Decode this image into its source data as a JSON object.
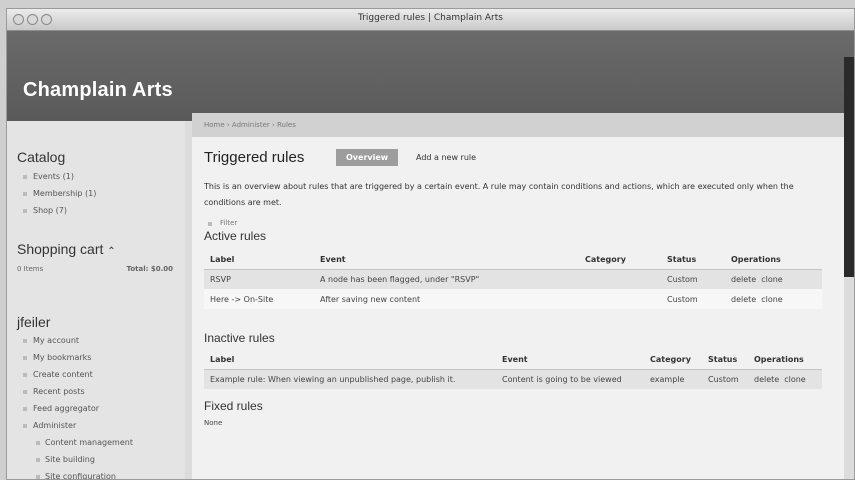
{
  "window": {
    "title": "Triggered rules | Champlain Arts"
  },
  "site": {
    "name": "Champlain Arts"
  },
  "breadcrumb": {
    "text": "Home › Administer › Rules"
  },
  "sidebar": {
    "catalog": {
      "title": "Catalog",
      "items": [
        "Events (1)",
        "Membership (1)",
        "Shop (7)"
      ]
    },
    "cart": {
      "title": "Shopping cart",
      "toggle": "⌃",
      "items_text": "0 Items",
      "total_text": "Total: $0.00"
    },
    "user": {
      "title": "jfeiler",
      "items": [
        "My account",
        "My bookmarks",
        "Create content",
        "Recent posts",
        "Feed aggregator",
        "Administer"
      ],
      "subitems": [
        "Content management",
        "Site building",
        "Site configuration"
      ]
    }
  },
  "main": {
    "title": "Triggered rules",
    "tabs": {
      "overview": "Overview",
      "add": "Add a new rule"
    },
    "description": "This is an overview about rules that are triggered by a certain event. A rule may contain conditions and actions, which are executed only when the conditions are met.",
    "filter_label": "Filter",
    "active": {
      "heading": "Active rules",
      "headers": [
        "Label",
        "Event",
        "Category",
        "Status",
        "Operations"
      ],
      "rows": [
        {
          "label": "RSVP",
          "event": "A node has been flagged, under \"RSVP\"",
          "category": "",
          "status": "Custom",
          "delete": "delete",
          "clone": "clone"
        },
        {
          "label": "Here -> On-Site",
          "event": "After saving new content",
          "category": "",
          "status": "Custom",
          "delete": "delete",
          "clone": "clone"
        }
      ]
    },
    "inactive": {
      "heading": "Inactive rules",
      "headers": [
        "Label",
        "Event",
        "Category",
        "Status",
        "Operations"
      ],
      "rows": [
        {
          "label": "Example rule: When viewing an unpublished page, publish it.",
          "event": "Content is going to be viewed",
          "category": "example",
          "status": "Custom",
          "delete": "delete",
          "clone": "clone"
        }
      ]
    },
    "fixed": {
      "heading": "Fixed rules",
      "none_text": "None"
    }
  }
}
